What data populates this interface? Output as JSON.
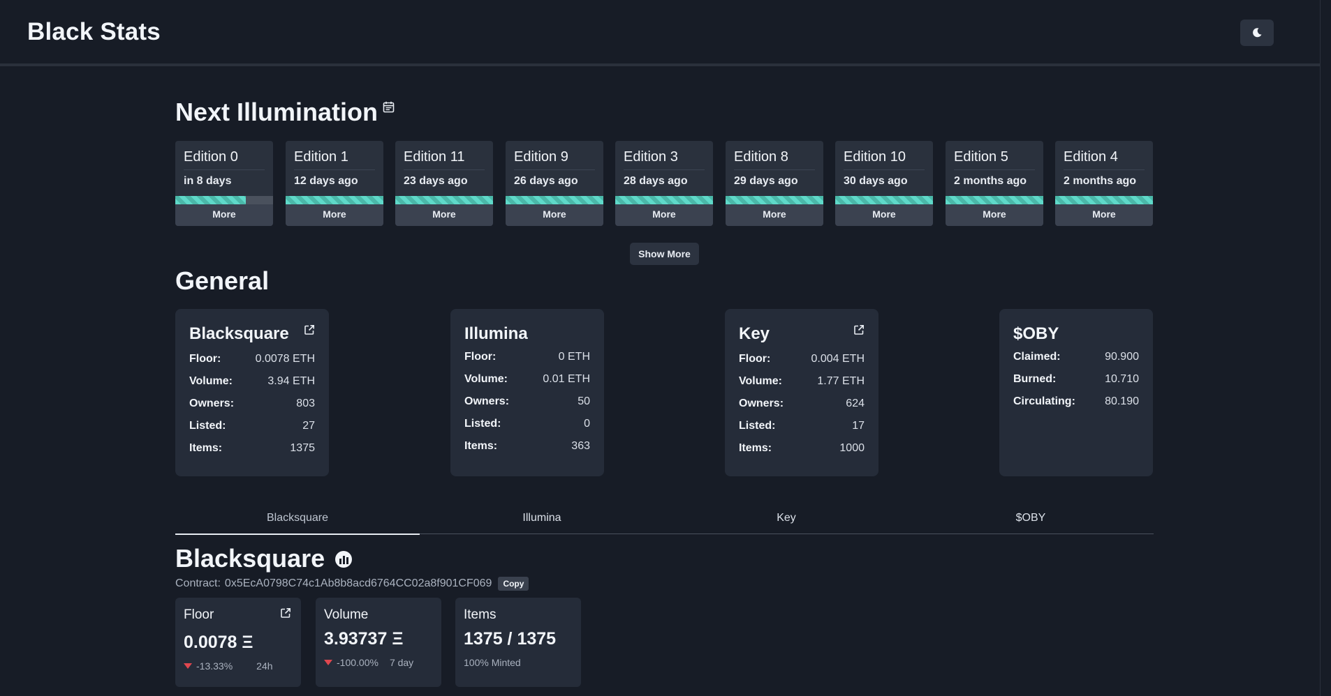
{
  "app": {
    "title": "Black Stats"
  },
  "next_illumination": {
    "heading": "Next Illumination",
    "editions": [
      {
        "title": "Edition 0",
        "when": "in 8 days",
        "progress": 0.72,
        "more": "More"
      },
      {
        "title": "Edition 1",
        "when": "12 days ago",
        "progress": 1.0,
        "more": "More"
      },
      {
        "title": "Edition 11",
        "when": "23 days ago",
        "progress": 1.0,
        "more": "More"
      },
      {
        "title": "Edition 9",
        "when": "26 days ago",
        "progress": 1.0,
        "more": "More"
      },
      {
        "title": "Edition 3",
        "when": "28 days ago",
        "progress": 1.0,
        "more": "More"
      },
      {
        "title": "Edition 8",
        "when": "29 days ago",
        "progress": 1.0,
        "more": "More"
      },
      {
        "title": "Edition 10",
        "when": "30 days ago",
        "progress": 1.0,
        "more": "More"
      },
      {
        "title": "Edition 5",
        "when": "2 months ago",
        "progress": 1.0,
        "more": "More"
      },
      {
        "title": "Edition 4",
        "when": "2 months ago",
        "progress": 1.0,
        "more": "More"
      }
    ],
    "show_more": "Show More"
  },
  "general": {
    "heading": "General",
    "cards": [
      {
        "title": "Blacksquare",
        "rows": [
          {
            "k": "Floor:",
            "v": "0.0078 ETH"
          },
          {
            "k": "Volume:",
            "v": "3.94 ETH"
          },
          {
            "k": "Owners:",
            "v": "803"
          },
          {
            "k": "Listed:",
            "v": "27"
          },
          {
            "k": "Items:",
            "v": "1375"
          }
        ]
      },
      {
        "title": "Illumina",
        "rows": [
          {
            "k": "Floor:",
            "v": "0 ETH"
          },
          {
            "k": "Volume:",
            "v": "0.01 ETH"
          },
          {
            "k": "Owners:",
            "v": "50"
          },
          {
            "k": "Listed:",
            "v": "0"
          },
          {
            "k": "Items:",
            "v": "363"
          }
        ]
      },
      {
        "title": "Key",
        "rows": [
          {
            "k": "Floor:",
            "v": "0.004 ETH"
          },
          {
            "k": "Volume:",
            "v": "1.77 ETH"
          },
          {
            "k": "Owners:",
            "v": "624"
          },
          {
            "k": "Listed:",
            "v": "17"
          },
          {
            "k": "Items:",
            "v": "1000"
          }
        ]
      },
      {
        "title": "$OBY",
        "rows": [
          {
            "k": "Claimed:",
            "v": "90.900"
          },
          {
            "k": "Burned:",
            "v": "10.710"
          },
          {
            "k": "Circulating:",
            "v": "80.190"
          }
        ]
      }
    ]
  },
  "tabs": [
    "Blacksquare",
    "Illumina",
    "Key",
    "$OBY"
  ],
  "detail": {
    "title": "Blacksquare",
    "contract_label": "Contract:",
    "contract": "0x5EcA0798C74c1Ab8b8acd6764CC02a8f901CF069",
    "copy": "Copy",
    "floor": {
      "label": "Floor",
      "value": "0.0078 Ξ",
      "change": "-13.33%",
      "period": "24h"
    },
    "volume": {
      "label": "Volume",
      "value": "3.93737 Ξ",
      "change": "-100.00%",
      "period": "7 day"
    },
    "items": {
      "label": "Items",
      "value": "1375 / 1375",
      "sub": "100% Minted"
    }
  },
  "colors": {
    "accent": "#5fd9c9",
    "down": "#e0474f",
    "bg": "#171c26",
    "card": "#252c39"
  }
}
